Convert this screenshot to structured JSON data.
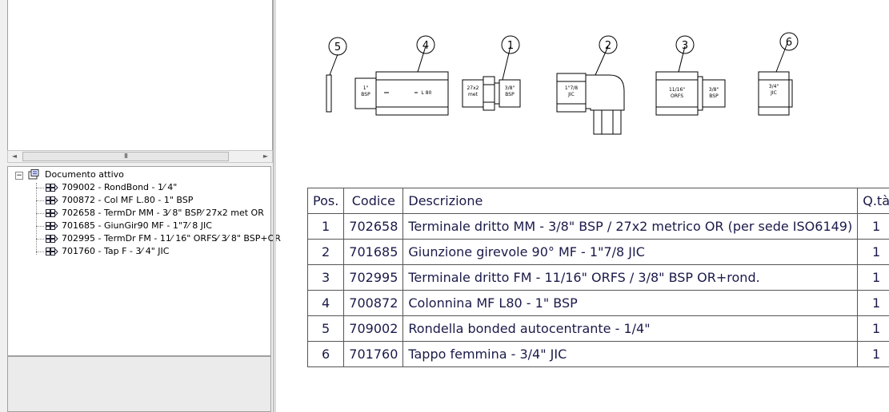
{
  "tree": {
    "root_label": "Documento attivo",
    "expander": "−",
    "scroll_thumb": "III",
    "scroll_left": "◄",
    "scroll_right": "►",
    "items": [
      {
        "label": "709002 - RondBond - 1⁄ 4\""
      },
      {
        "label": "700872 - Col MF L.80 - 1\" BSP"
      },
      {
        "label": "702658 - TermDr MM - 3⁄ 8\" BSP⁄  27x2 met OR"
      },
      {
        "label": "701685 - GiunGir90 MF - 1\"7⁄ 8 JIC"
      },
      {
        "label": "702995 - TermDr FM - 11⁄ 16\" ORFS⁄  3⁄ 8\" BSP+OR"
      },
      {
        "label": "701760 - Tap F - 3⁄ 4\" JIC"
      }
    ]
  },
  "drawing": {
    "balloons": [
      "5",
      "4",
      "1",
      "2",
      "3",
      "6"
    ],
    "labels": {
      "p4_left": [
        "1\"",
        "BSP"
      ],
      "p4_right": "L 80",
      "p1_left": [
        "27x2",
        "met"
      ],
      "p1_right": [
        "3/8\"",
        "BSP"
      ],
      "p2": [
        "1\"7/8",
        "JIC"
      ],
      "p3_left": [
        "11/16\"",
        "ORFS"
      ],
      "p3_right": [
        "3/8\"",
        "BSP"
      ],
      "p6": [
        "3/4\"",
        "JIC"
      ]
    }
  },
  "bom": {
    "headers": {
      "pos": "Pos.",
      "codice": "Codice",
      "descrizione": "Descrizione",
      "qta": "Q.tà"
    },
    "rows": [
      {
        "pos": "1",
        "codice": "702658",
        "descrizione": "Terminale dritto MM - 3/8\" BSP / 27x2 metrico OR (per sede ISO6149)",
        "qta": "1"
      },
      {
        "pos": "2",
        "codice": "701685",
        "descrizione": "Giunzione girevole 90° MF - 1\"7/8 JIC",
        "qta": "1"
      },
      {
        "pos": "3",
        "codice": "702995",
        "descrizione": "Terminale dritto FM - 11/16\" ORFS / 3/8\" BSP OR+rond.",
        "qta": "1"
      },
      {
        "pos": "4",
        "codice": "700872",
        "descrizione": "Colonnina MF L80 - 1\" BSP",
        "qta": "1"
      },
      {
        "pos": "5",
        "codice": "709002",
        "descrizione": "Rondella bonded autocentrante - 1/4\"",
        "qta": "1"
      },
      {
        "pos": "6",
        "codice": "701760",
        "descrizione": "Tappo femmina - 3/4\" JIC",
        "qta": "1"
      }
    ]
  }
}
